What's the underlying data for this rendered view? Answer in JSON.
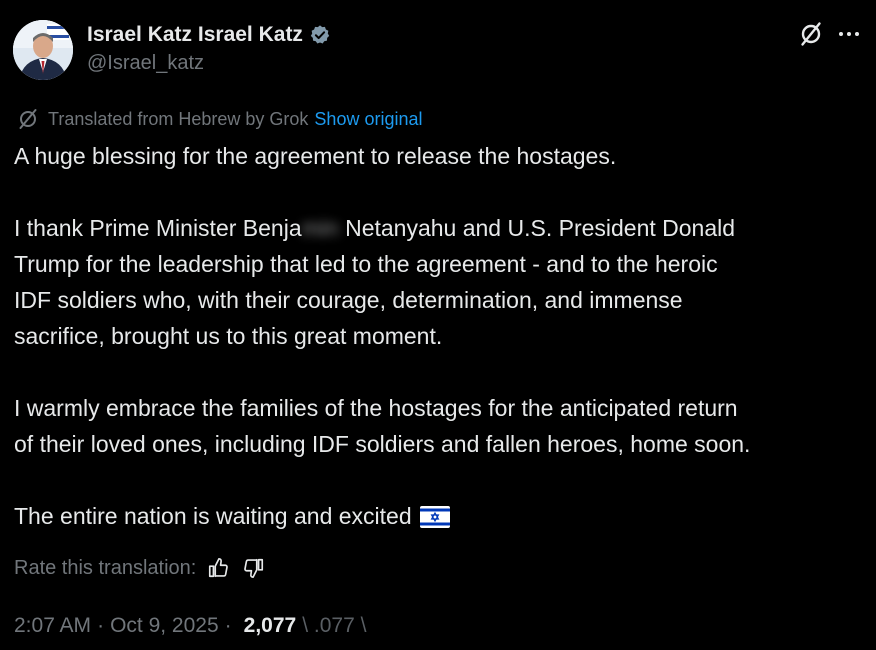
{
  "author": {
    "display_name": "Israel Katz Israel Katz",
    "handle": "@Israel_katz",
    "verified_icon": "verified-badge-icon",
    "avatar_icon": "profile-photo"
  },
  "header_actions": {
    "grok_icon": "grok-icon",
    "more_icon": "more-dots-icon"
  },
  "translation": {
    "note": "Translated from Hebrew by Grok",
    "show_original": "Show original",
    "rate_label": "Rate this translation:",
    "thumbs_up_icon": "thumbs-up-icon",
    "thumbs_down_icon": "thumbs-down-icon"
  },
  "post": {
    "line1": "A huge blessing for the agreement to release the hostages.",
    "line2": "I thank Prime Minister Benja",
    "line2_hidden": "min",
    "line2_rest": " Netanyahu and U.S. President Donald",
    "line3": "Trump for the leadership that led to the agreement - and to the heroic",
    "line4": "IDF soldiers who, with their courage, determination, and immense",
    "line5": "sacrifice, brought us to this great moment.",
    "line6": "I warmly embrace the families of the hostages for the anticipated return",
    "line7": "of their loved ones, including IDF soldiers and fallen heroes, home soon.",
    "line8": "The entire nation is waiting and excited",
    "flag_icon": "israel-flag-icon"
  },
  "meta": {
    "time": "2:07 AM",
    "date": "Oct 9, 2025",
    "separator": "·",
    "views_count": "2,077",
    "views_tail": "\\ .077 \\"
  },
  "colors": {
    "background": "#000000",
    "text": "#e7e9ea",
    "muted": "#71767b",
    "link": "#1d9bf0",
    "verified": "#829aab"
  }
}
